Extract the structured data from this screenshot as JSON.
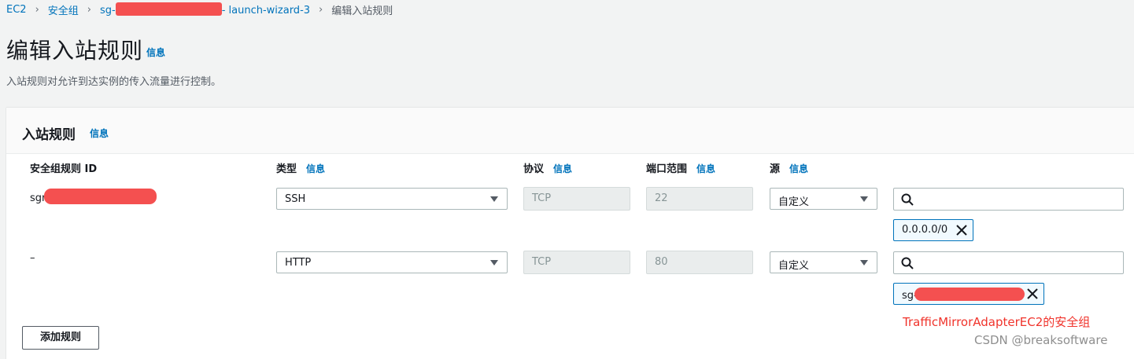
{
  "breadcrumb": {
    "ec2": "EC2",
    "security_groups": "安全组",
    "sg_prefix": "sg-",
    "sg_suffix": "- launch-wizard-3",
    "current": "编辑入站规则"
  },
  "page": {
    "title": "编辑入站规则",
    "info_link": "信息",
    "description": "入站规则对允许到达实例的传入流量进行控制。"
  },
  "panel": {
    "title": "入站规则",
    "info_link": "信息",
    "columns": {
      "rule_id": "安全组规则 ID",
      "type": "类型",
      "type_info": "信息",
      "protocol": "协议",
      "protocol_info": "信息",
      "port_range": "端口范围",
      "port_range_info": "信息",
      "source": "源",
      "source_info": "信息"
    },
    "rules": [
      {
        "rule_id": "sgr",
        "type": "SSH",
        "protocol": "TCP",
        "port_range": "22",
        "source_type": "自定义",
        "search_value": "",
        "token": "0.0.0.0/0"
      },
      {
        "rule_id": "–",
        "type": "HTTP",
        "protocol": "TCP",
        "port_range": "80",
        "source_type": "自定义",
        "search_value": "",
        "token": "sg-"
      }
    ],
    "add_rule_label": "添加规则"
  },
  "annotation": "TrafficMirrorAdapterEC2的安全组",
  "watermark": "CSDN @breaksoftware",
  "colors": {
    "link": "#0073bb",
    "redaction": "#f45050",
    "annotation": "#f0332b",
    "background": "#f2f3f3"
  },
  "icons": [
    "chevron-right-icon",
    "caret-down-icon",
    "search-icon",
    "close-icon"
  ]
}
